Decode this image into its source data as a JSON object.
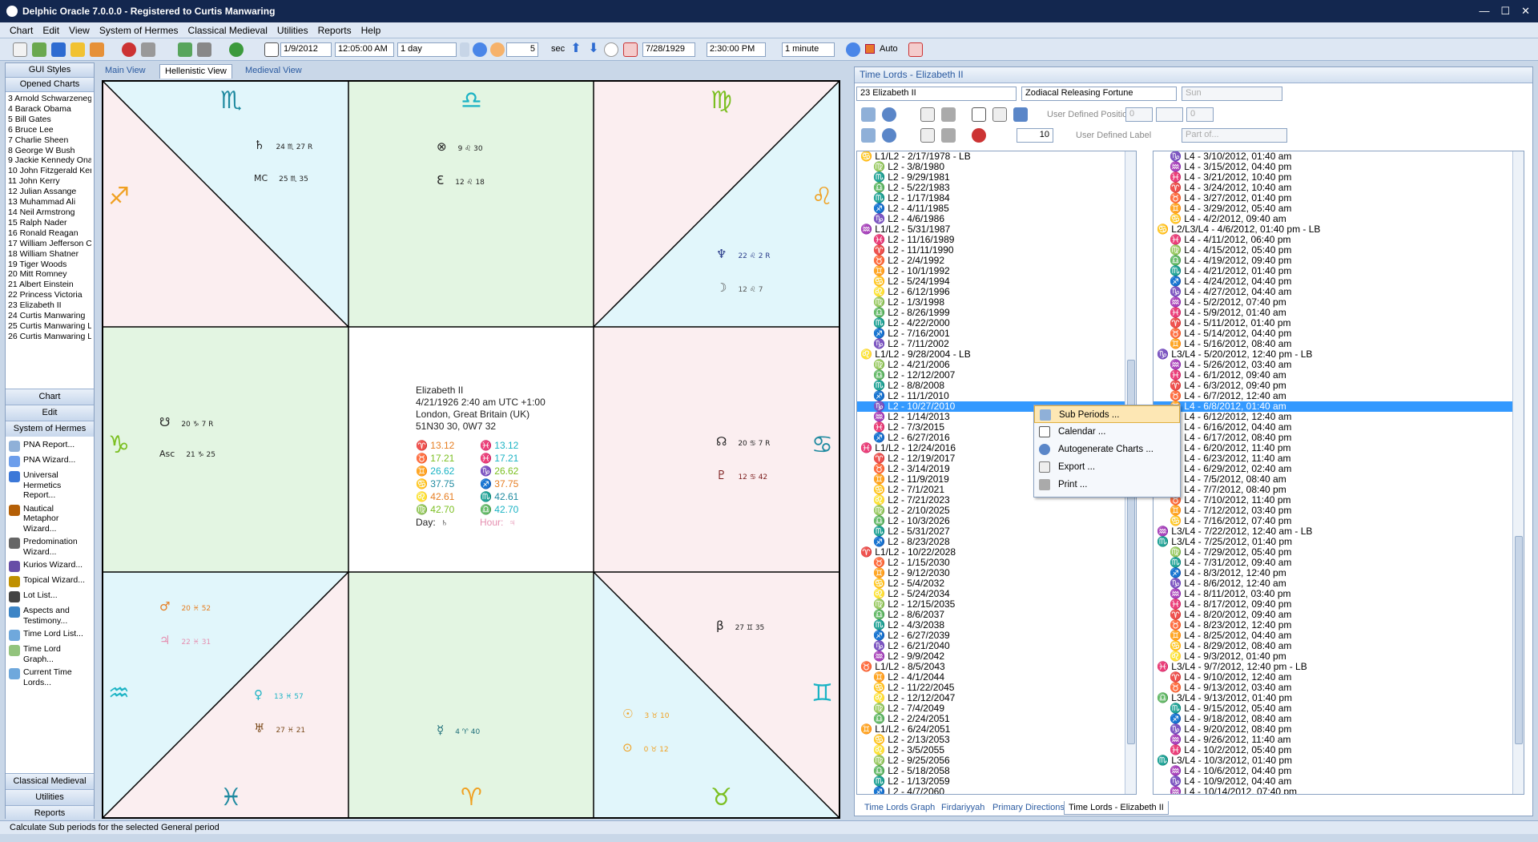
{
  "window": {
    "title": "Delphic Oracle 7.0.0.0 -  Registered to Curtis Manwaring"
  },
  "menu": [
    "Chart",
    "Edit",
    "View",
    "System of Hermes",
    "Classical Medieval",
    "Utilities",
    "Reports",
    "Help"
  ],
  "toolbar": {
    "date1": "1/9/2012",
    "time1": "12:05:00 AM",
    "step1": "1 day",
    "num1": "5",
    "unit1": "sec",
    "date2": "7/28/1929",
    "time2": "2:30:00 PM",
    "step2": "1 minute",
    "auto_label": "Auto"
  },
  "left": {
    "gui_styles": "GUI Styles",
    "opened_charts": "Opened Charts",
    "charts": [
      "3 Arnold Schwarzeneg",
      "4 Barack Obama",
      "5 Bill Gates",
      "6 Bruce Lee",
      "7 Charlie Sheen",
      "8 George W Bush",
      "9 Jackie Kennedy Ona",
      "10 John Fitzgerald Ker",
      "11 John Kerry",
      "12 Julian Assange",
      "13 Muhammad Ali",
      "14 Neil Armstrong",
      "15 Ralph Nader",
      "16 Ronald Reagan",
      "17 William Jefferson C",
      "18 William Shatner",
      "19 Tiger Woods",
      "20 Mitt Romney",
      "21 Albert Einstein",
      "22 Princess Victoria",
      "23 Elizabeth II",
      "24 Curtis Manwaring",
      "25 Curtis Manwaring L",
      "26 Curtis Manwaring L"
    ],
    "chart_label": "Chart",
    "edit_label": "Edit",
    "hermes_label": "System of Hermes",
    "tools": [
      {
        "label": "PNA Report...",
        "icon": "document-icon"
      },
      {
        "label": "PNA Wizard...",
        "icon": "wizard-icon"
      },
      {
        "label": "Universal Hermetics Report...",
        "icon": "globe-icon"
      },
      {
        "label": "Nautical Metaphor Wizard...",
        "icon": "ship-wheel-icon"
      },
      {
        "label": "Predomination Wizard...",
        "icon": "ball-icon"
      },
      {
        "label": "Kurios Wizard...",
        "icon": "person-icon"
      },
      {
        "label": "Topical Wizard...",
        "icon": "key-icon"
      },
      {
        "label": "Lot List...",
        "icon": "anchor-icon"
      },
      {
        "label": "Aspects and Testimony...",
        "icon": "eye-icon"
      },
      {
        "label": "Time Lord List...",
        "icon": "clock-icon"
      },
      {
        "label": "Time Lord Graph...",
        "icon": "graph-icon"
      },
      {
        "label": "Current Time Lords...",
        "icon": "clock-icon"
      }
    ],
    "classical_label": "Classical Medieval",
    "utilities_label": "Utilities",
    "reports_label": "Reports"
  },
  "tabs": [
    "Main View",
    "Hellenistic View",
    "Medieval View"
  ],
  "chart": {
    "signs": {
      "scorpio": "♏",
      "leo_top": "♌",
      "virgo": "♍",
      "sagittarius": "♐",
      "leo": "♌",
      "capricorn": "♑",
      "cancer": "♋",
      "aquarius": "♒",
      "gemini": "♊",
      "pisces": "♓",
      "aries": "♈",
      "taurus": "♉",
      "libra": "♎"
    },
    "pl_saturn": {
      "g": "♄",
      "t": "24 ♏ 27 R"
    },
    "pl_mc": {
      "g": "MC",
      "t": "25 ♏ 35"
    },
    "pl_lot": {
      "g": "⊗",
      "t": "9 ♌ 30"
    },
    "pl_e": {
      "g": "Ɛ",
      "t": "12 ♌ 18"
    },
    "pl_neptune": {
      "g": "♆",
      "t": "22 ♌ 2 R"
    },
    "pl_moon": {
      "g": "☽",
      "t": "12 ♌ 7"
    },
    "pl_northnode": {
      "g": "☋",
      "t": "20 ♑ 7 R"
    },
    "pl_asc": {
      "g": "Asc",
      "t": "21 ♑ 25"
    },
    "pl_southnode": {
      "g": "☊",
      "t": "20 ♋ 7 R"
    },
    "pl_pluto": {
      "g": "♇",
      "t": "12 ♋ 42"
    },
    "pl_mars": {
      "g": "♂",
      "t": "20 ♓ 52"
    },
    "pl_jupiter": {
      "g": "♃",
      "t": "22 ♓ 31"
    },
    "pl_venus": {
      "g": "♀",
      "t": "13 ♓ 57"
    },
    "pl_uranus": {
      "g": "♅",
      "t": "27 ♓ 21"
    },
    "pl_mercury": {
      "g": "☿",
      "t": "4 ♈ 40"
    },
    "pl_beta": {
      "g": "β",
      "t": "27 ♊ 35"
    },
    "pl_sun": {
      "g": "☉",
      "t": "3 ♉ 10"
    },
    "pl_fortune": {
      "g": "⊙",
      "t": "0 ♉ 12"
    },
    "info": {
      "name": "Elizabeth II",
      "date": "4/21/1926  2:40 am  UTC +1:00",
      "place": "London, Great Britain (UK)",
      "coords": "51N30 30,  0W7 32",
      "day_label": "Day:",
      "day_val": "♄",
      "hour_label": "Hour:",
      "hour_val": "♃"
    },
    "rows": [
      [
        "♈  13.12",
        "♓  13.12"
      ],
      [
        "♉  17.21",
        "♓  17.21"
      ],
      [
        "♊  26.62",
        "♑  26.62"
      ],
      [
        "♋  37.75",
        "♐  37.75"
      ],
      [
        "♌  42.61",
        "♏  42.61"
      ],
      [
        "♍  42.70",
        "♎  42.70"
      ]
    ]
  },
  "right": {
    "title": "Time Lords - Elizabeth II",
    "chart_select": "23 Elizabeth II",
    "method": "Zodiacal Releasing Fortune",
    "body": "Sun",
    "udp_label": "User Defined Position",
    "udl_label": "User Defined Label",
    "part_placeholder": "Part of...",
    "num10": "10",
    "num0a": "0",
    "num0b": "0",
    "list1": [
      "♋ L1/L2 - 2/17/1978 - LB",
      "♍ L2 - 3/8/1980",
      "♏ L2 - 9/29/1981",
      "♎ L2 - 5/22/1983",
      "♏ L2 - 1/17/1984",
      "♐ L2 - 4/11/1985",
      "♑ L2 - 4/6/1986",
      "♒ L1/L2 - 5/31/1987",
      "♓ L2 - 11/16/1989",
      "♈ L2 - 11/11/1990",
      "♉ L2 - 2/4/1992",
      "♊ L2 - 10/1/1992",
      "♋ L2 - 5/24/1994",
      "♌ L2 - 6/12/1996",
      "♍ L2 - 1/3/1998",
      "♎ L2 - 8/26/1999",
      "♏ L2 - 4/22/2000",
      "♐ L2 - 7/16/2001",
      "♑ L2 - 7/11/2002",
      "♌ L1/L2 - 9/28/2004 - LB",
      "♍ L2 - 4/21/2006",
      "♎ L2 - 12/12/2007",
      "♏ L2 - 8/8/2008",
      "♐ L2 - 11/1/2010",
      "♑ L2 - 10/27/2010",
      "♒ L2 - 1/14/2013",
      "♓ L2 - 7/3/2015",
      "♐ L2 - 6/27/2016",
      "♓ L1/L2 - 12/24/2016",
      "♈ L2 - 12/19/2017",
      "♉ L2 - 3/14/2019",
      "♊ L2 - 11/9/2019",
      "♋ L2 - 7/1/2021",
      "♌ L2 - 7/21/2023",
      "♍ L2 - 2/10/2025",
      "♎ L2 - 10/3/2026",
      "♏ L2 - 5/31/2027",
      "♐ L2 - 8/23/2028",
      "♈ L1/L2 - 10/22/2028",
      "♉ L2 - 1/15/2030",
      "♊ L2 - 9/12/2030",
      "♋ L2 - 5/4/2032",
      "♌ L2 - 5/24/2034",
      "♍ L2 - 12/15/2035",
      "♎ L2 - 8/6/2037",
      "♏ L2 - 4/3/2038",
      "♐ L2 - 6/27/2039",
      "♑ L2 - 6/21/2040",
      "♒ L2 - 9/9/2042",
      "♉ L1/L2 - 8/5/2043",
      "♊ L2 - 4/1/2044",
      "♋ L2 - 11/22/2045",
      "♌ L2 - 12/12/2047",
      "♍ L2 - 7/4/2049",
      "♎ L2 - 2/24/2051",
      "♊ L1/L2 - 6/24/2051",
      "♋ L2 - 2/13/2053",
      "♌ L2 - 3/5/2055",
      "♍ L2 - 9/25/2056",
      "♎ L2 - 5/18/2058",
      "♏ L2 - 1/13/2059",
      "♐ L2 - 4/7/2060"
    ],
    "list2": [
      "♑ L4 - 3/10/2012, 01:40 am",
      "♒ L4 - 3/15/2012, 04:40 pm",
      "♓ L4 - 3/21/2012, 10:40 pm",
      "♈ L4 - 3/24/2012, 10:40 am",
      "♉ L4 - 3/27/2012, 01:40 pm",
      "♊ L4 - 3/29/2012, 05:40 am",
      "♋ L4 - 4/2/2012, 09:40 am",
      "♋ L2/L3/L4 - 4/6/2012, 01:40 pm - LB",
      "♓ L4 - 4/11/2012, 06:40 pm",
      "♍ L4 - 4/15/2012, 05:40 pm",
      "♎ L4 - 4/19/2012, 09:40 pm",
      "♏ L4 - 4/21/2012, 01:40 pm",
      "♐ L4 - 4/24/2012, 04:40 pm",
      "♑ L4 - 4/27/2012, 04:40 am",
      "♒ L4 - 5/2/2012, 07:40 pm",
      "♓ L4 - 5/9/2012, 01:40 am",
      "♈ L4 - 5/11/2012, 01:40 pm",
      "♉ L4 - 5/14/2012, 04:40 pm",
      "♊ L4 - 5/16/2012, 08:40 am",
      "♑ L3/L4 - 5/20/2012, 12:40 pm - LB",
      "♒ L4 - 5/26/2012, 03:40 am",
      "♓ L4 - 6/1/2012, 09:40 am",
      "♈ L4 - 6/3/2012, 09:40 pm",
      "♉ L4 - 6/7/2012, 12:40 am",
      "♊ L4 - 6/8/2012, 01:40 am",
      "♍ L4 - 6/12/2012, 12:40 am",
      "♎ L4 - 6/16/2012, 04:40 am",
      "♏ L4 - 6/17/2012, 08:40 pm",
      "♐ L4 - 6/20/2012, 11:40 pm",
      "♑ L4 - 6/23/2012, 11:40 am",
      "♒ L4 - 6/29/2012, 02:40 am",
      "♓ L4 - 7/5/2012, 08:40 am",
      "♈ L4 - 7/7/2012, 08:40 pm",
      "♉ L4 - 7/10/2012, 11:40 pm",
      "♊ L4 - 7/12/2012, 03:40 pm",
      "♋ L4 - 7/16/2012, 07:40 pm",
      "♒ L3/L4 - 7/22/2012, 12:40 am - LB",
      "♏ L3/L4 - 7/25/2012, 01:40 pm",
      "♍ L4 - 7/29/2012, 05:40 pm",
      "♏ L4 - 7/31/2012, 09:40 am",
      "♐ L4 - 8/3/2012, 12:40 pm",
      "♑ L4 - 8/6/2012, 12:40 am",
      "♒ L4 - 8/11/2012, 03:40 pm",
      "♓ L4 - 8/17/2012, 09:40 pm",
      "♈ L4 - 8/20/2012, 09:40 am",
      "♉ L4 - 8/23/2012, 12:40 pm",
      "♊ L4 - 8/25/2012, 04:40 am",
      "♋ L4 - 8/29/2012, 08:40 am",
      "♌ L4 - 9/3/2012, 01:40 pm",
      "♓ L3/L4 - 9/7/2012, 12:40 pm - LB",
      "♈ L4 - 9/10/2012, 12:40 am",
      "♉ L4 - 9/13/2012, 03:40 am",
      "♎ L3/L4 - 9/13/2012, 01:40 pm",
      "♏ L4 - 9/15/2012, 05:40 am",
      "♐ L4 - 9/18/2012, 08:40 am",
      "♑ L4 - 9/20/2012, 08:40 pm",
      "♒ L4 - 9/26/2012, 11:40 am",
      "♓ L4 - 10/2/2012, 05:40 pm",
      "♏ L3/L4 - 10/3/2012, 01:40 pm",
      "♒ L4 - 10/6/2012, 04:40 pm",
      "♑ L4 - 10/9/2012, 04:40 am",
      "♒ L4 - 10/14/2012, 07:40 pm"
    ],
    "context": [
      "Sub Periods ...",
      "Calendar ...",
      "Autogenerate Charts ...",
      "Export ...",
      "Print ..."
    ],
    "bottom_tabs": [
      "Time Lords Graph",
      "Firdariyyah",
      "Primary Directions",
      "Time Lords - Elizabeth II"
    ]
  },
  "status": "Calculate Sub periods for the selected General period"
}
